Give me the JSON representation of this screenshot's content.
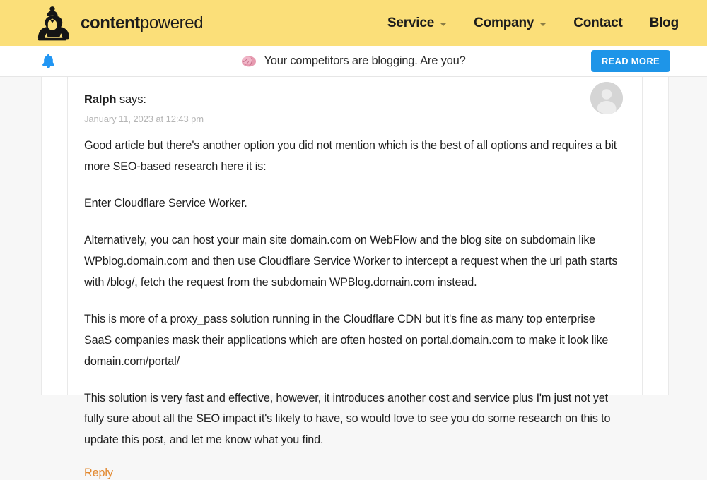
{
  "header": {
    "brand": {
      "logo_icon": "sumo-wrestler-logo",
      "text_bold": "content",
      "text_light": "powered"
    },
    "nav": [
      {
        "label": "Service",
        "has_dropdown": true
      },
      {
        "label": "Company",
        "has_dropdown": true
      },
      {
        "label": "Contact",
        "has_dropdown": false
      },
      {
        "label": "Blog",
        "has_dropdown": false
      }
    ],
    "background_color": "#fbdf79"
  },
  "notification_bar": {
    "bell_icon": "bell-icon",
    "bell_color": "#2196f3",
    "emoji_icon": "brain-emoji",
    "message": "Your competitors are blogging. Are you?",
    "cta_label": "READ MORE",
    "cta_color": "#1e95e8"
  },
  "comment": {
    "author": "Ralph",
    "says_suffix": "says:",
    "date": "January 11, 2023 at 12:43 pm",
    "avatar_icon": "default-user-avatar",
    "paragraphs": [
      "Good article but there's another option you did not mention which is the best of all options and requires a bit more SEO-based research here it is:",
      "Enter Cloudflare Service Worker.",
      "Alternatively, you can host your main site domain.com on WebFlow and the blog site on subdomain like WPblog.domain.com and then use Cloudflare Service Worker to intercept a request when the url path starts with /blog/, fetch the request from the subdomain WPBlog.domain.com instead.",
      "This is more of a proxy_pass solution running in the Cloudflare CDN but it's fine as many top enterprise SaaS companies mask their applications which are often hosted on portal.domain.com to make it look like domain.com/portal/",
      "This solution is very fast and effective, however, it introduces another cost and service plus I'm just not yet fully sure about all the SEO impact it's likely to have, so would love to see you do some research on this to update this post, and let me know what you find."
    ],
    "reply_label": "Reply",
    "reply_color": "#e2882f"
  }
}
